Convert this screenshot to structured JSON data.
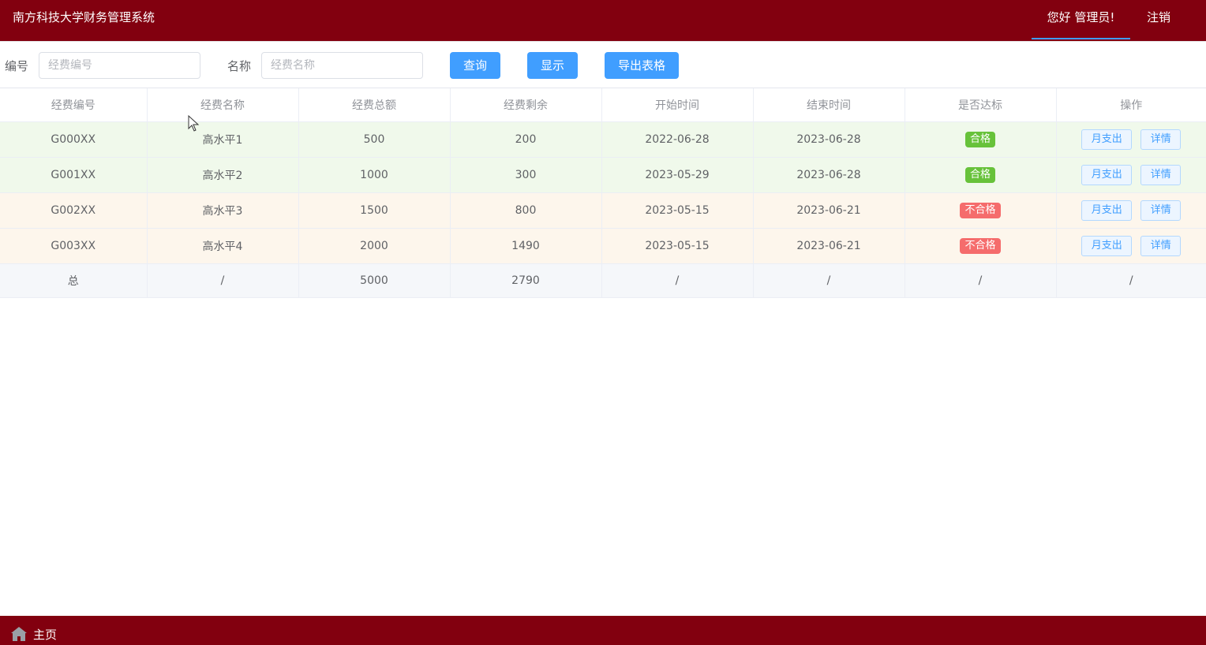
{
  "header": {
    "app_title": "南方科技大学财务管理系统",
    "greeting": "您好 管理员!",
    "logout": "注销"
  },
  "search": {
    "id_label": "编号",
    "id_placeholder": "经费编号",
    "name_label": "名称",
    "name_placeholder": "经费名称",
    "query_button": "查询",
    "show_button": "显示",
    "export_button": "导出表格"
  },
  "table": {
    "columns": [
      "经费编号",
      "经费名称",
      "经费总额",
      "经费剩余",
      "开始时间",
      "结束时间",
      "是否达标",
      "操作"
    ],
    "rows": [
      {
        "id": "G000XX",
        "name": "高水平1",
        "total": "500",
        "remaining": "200",
        "start": "2022-06-28",
        "end": "2023-06-28",
        "status": "合格",
        "action_month": "月支出",
        "action_detail": "详情"
      },
      {
        "id": "G001XX",
        "name": "高水平2",
        "total": "1000",
        "remaining": "300",
        "start": "2023-05-29",
        "end": "2023-06-28",
        "status": "合格",
        "action_month": "月支出",
        "action_detail": "详情"
      },
      {
        "id": "G002XX",
        "name": "高水平3",
        "total": "1500",
        "remaining": "800",
        "start": "2023-05-15",
        "end": "2023-06-21",
        "status": "不合格",
        "action_month": "月支出",
        "action_detail": "详情"
      },
      {
        "id": "G003XX",
        "name": "高水平4",
        "total": "2000",
        "remaining": "1490",
        "start": "2023-05-15",
        "end": "2023-06-21",
        "status": "不合格",
        "action_month": "月支出",
        "action_detail": "详情"
      }
    ],
    "summary": [
      "总",
      "/",
      "5000",
      "2790",
      "/",
      "/",
      "/",
      "/"
    ]
  },
  "footer": {
    "home_label": "主页"
  },
  "colors": {
    "brand": "#82000f",
    "primary": "#409eff",
    "success": "#67c23a",
    "danger": "#f56c6c"
  },
  "icons": {
    "home": "home-icon",
    "cursor": "mouse-cursor-icon"
  }
}
